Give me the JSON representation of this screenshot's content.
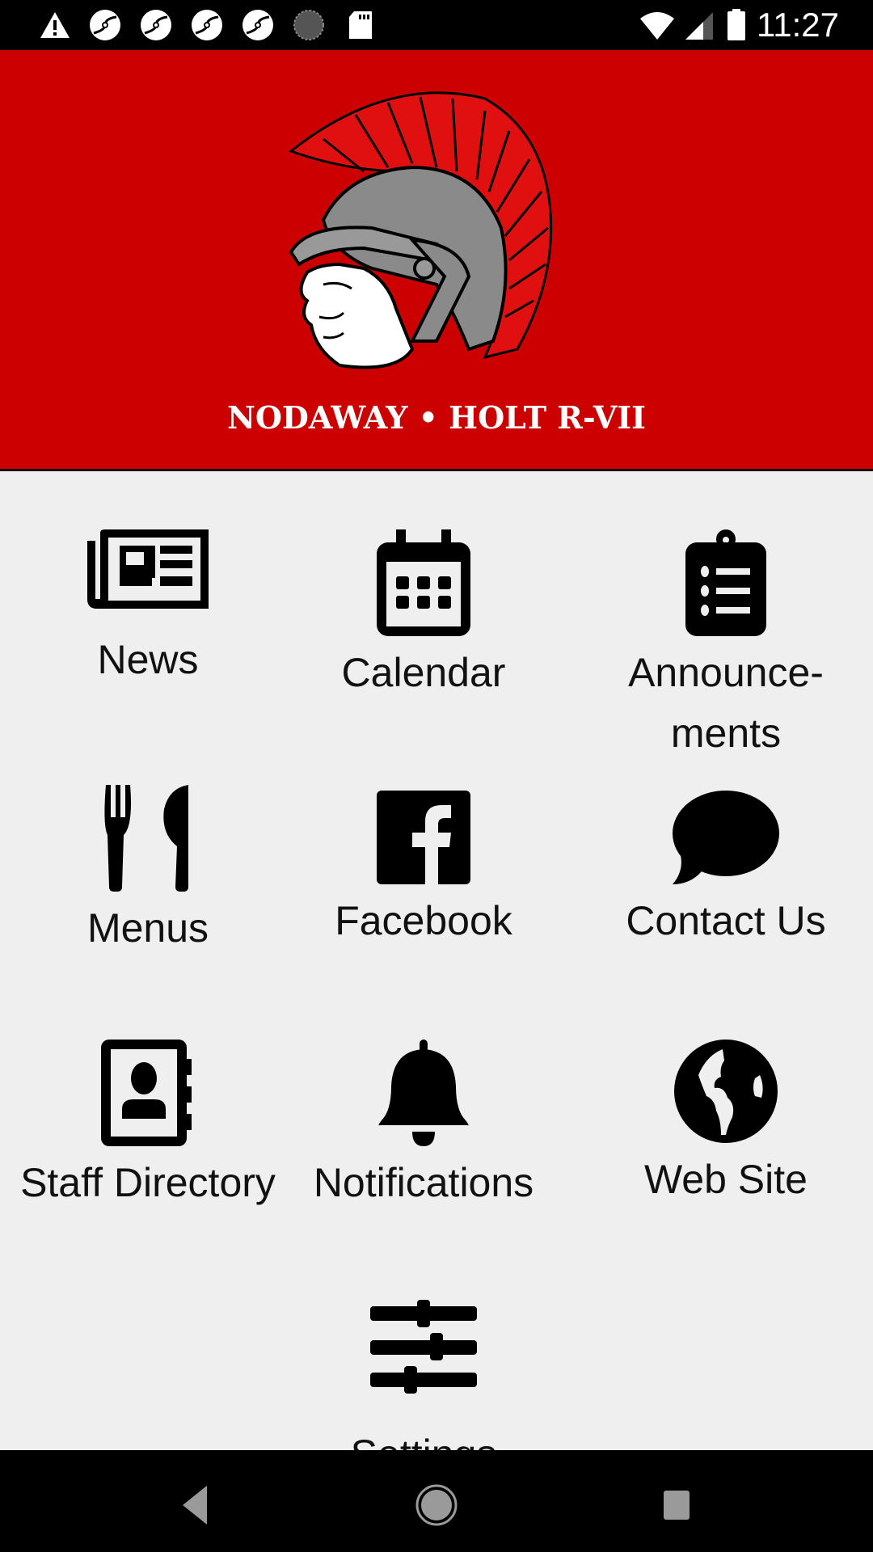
{
  "status_bar": {
    "time": "11:27",
    "left_icons": [
      "warning-icon",
      "sync-icon",
      "sync-icon",
      "sync-icon",
      "sync-icon",
      "loading-icon",
      "sd-card-icon"
    ],
    "right_icons": [
      "wifi-icon",
      "cell-signal-icon",
      "battery-icon"
    ]
  },
  "header": {
    "school_name": "NODAWAY • HOLT R-VII",
    "logo": "trojan-helmet-mascot",
    "background_color": "#cc0000"
  },
  "menu": {
    "items": [
      {
        "label": "News",
        "icon": "newspaper-icon"
      },
      {
        "label": "Calendar",
        "icon": "calendar-icon"
      },
      {
        "label": "Announce-\nments",
        "icon": "clipboard-list-icon"
      },
      {
        "label": "Menus",
        "icon": "utensils-icon"
      },
      {
        "label": "Facebook",
        "icon": "facebook-icon"
      },
      {
        "label": "Contact Us",
        "icon": "chat-bubble-icon"
      },
      {
        "label": "Staff Directory",
        "icon": "address-book-icon"
      },
      {
        "label": "Notifications",
        "icon": "bell-icon"
      },
      {
        "label": "Web Site",
        "icon": "globe-icon"
      },
      {
        "label": "Settings",
        "icon": "sliders-icon"
      }
    ]
  },
  "nav_bar": {
    "buttons": [
      "back",
      "home",
      "recents"
    ]
  }
}
